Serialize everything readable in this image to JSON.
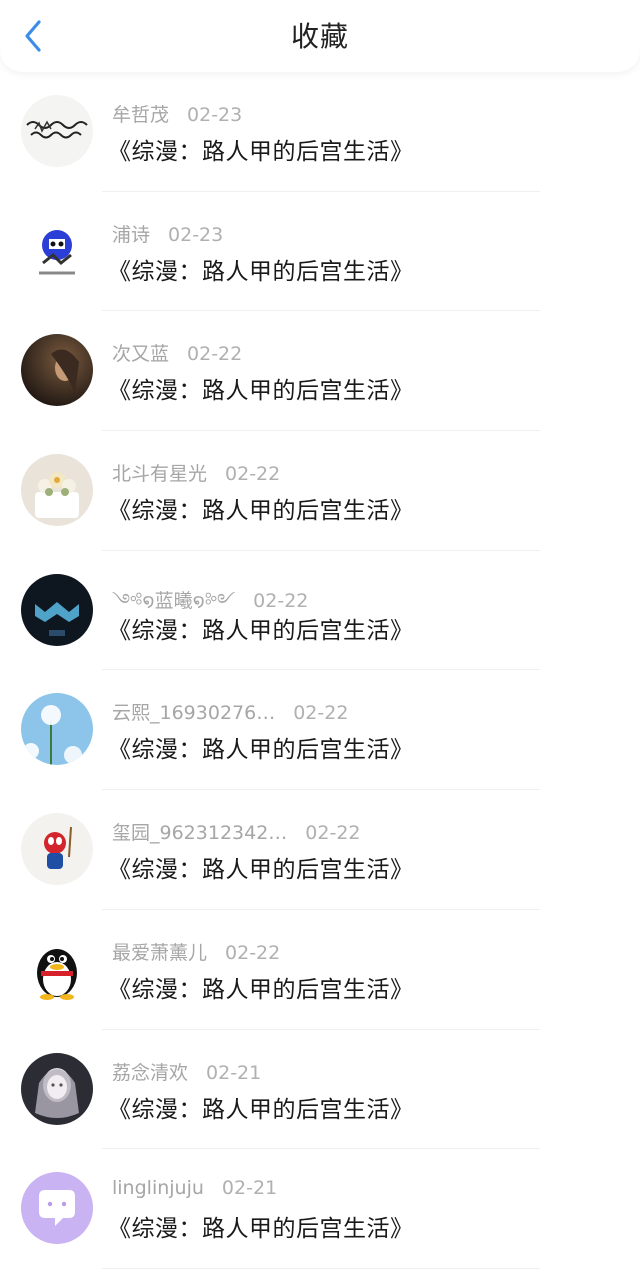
{
  "header": {
    "title": "收藏",
    "back_icon": "chevron-left-icon",
    "accent_color": "#3a8ee6"
  },
  "items": [
    {
      "user": "牟哲茂",
      "date": "02-23",
      "book": "《综漫：路人甲的后宫生活》"
    },
    {
      "user": "浦诗",
      "date": "02-23",
      "book": "《综漫：路人甲的后宫生活》"
    },
    {
      "user": "次又蓝",
      "date": "02-22",
      "book": "《综漫：路人甲的后宫生活》"
    },
    {
      "user": "北斗有星光",
      "date": "02-22",
      "book": "《综漫：路人甲的后宫生活》"
    },
    {
      "user": "༺໑蓝曦໑༻",
      "date": "02-22",
      "book": "《综漫：路人甲的后宫生活》"
    },
    {
      "user": "云熙_16930276…",
      "date": "02-22",
      "book": "《综漫：路人甲的后宫生活》"
    },
    {
      "user": "玺园_962312342…",
      "date": "02-22",
      "book": "《综漫：路人甲的后宫生活》"
    },
    {
      "user": "最爱萧薰儿",
      "date": "02-22",
      "book": "《综漫：路人甲的后宫生活》"
    },
    {
      "user": "荔念清欢",
      "date": "02-21",
      "book": "《综漫：路人甲的后宫生活》"
    },
    {
      "user": "linglinjuju",
      "date": "02-21",
      "book": "《综漫：路人甲的后宫生活》"
    }
  ]
}
